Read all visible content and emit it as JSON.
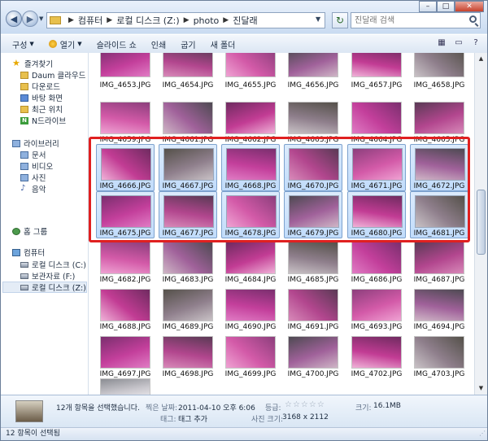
{
  "address": {
    "crumbs": [
      "컴퓨터",
      "로컬 디스크 (Z:)",
      "photo",
      "진달래"
    ]
  },
  "search": {
    "placeholder": "진달래 검색"
  },
  "toolbar": {
    "organize": "구성",
    "open": "열기",
    "slideshow": "슬라이드 쇼",
    "print": "인쇄",
    "burn": "굽기",
    "new_folder": "새 폴더"
  },
  "nav": {
    "favorites": "즐겨찾기",
    "daum_cloud": "Daum 클라우드",
    "downloads": "다운로드",
    "desktop": "바탕 화면",
    "recent": "최근 위치",
    "ndrive": "N드라이브",
    "libraries": "라이브러리",
    "documents": "문서",
    "videos": "비디오",
    "pictures": "사진",
    "music": "음악",
    "homegroup": "홈 그룹",
    "computer": "컴퓨터",
    "local_c": "로컬 디스크 (C:)",
    "backup_f": "보관자료 (F:)",
    "local_z": "로컬 디스크 (Z:)"
  },
  "files": {
    "row1": [
      "IMG_4653.JPG",
      "IMG_4654.JPG",
      "IMG_4655.JPG",
      "IMG_4656.JPG",
      "IMG_4657.JPG",
      "IMG_4658.JPG"
    ],
    "row2": [
      "IMG_4659.JPG",
      "IMG_4661.JPG",
      "IMG_4662.JPG",
      "IMG_4663.JPG",
      "IMG_4664.JPG",
      "IMG_4665.JPG"
    ],
    "row3": [
      "IMG_4666.JPG",
      "IMG_4667.JPG",
      "IMG_4668.JPG",
      "IMG_4670.JPG",
      "IMG_4671.JPG",
      "IMG_4672.JPG"
    ],
    "row4": [
      "IMG_4675.JPG",
      "IMG_4677.JPG",
      "IMG_4678.JPG",
      "IMG_4679.JPG",
      "IMG_4680.JPG",
      "IMG_4681.JPG"
    ],
    "row5": [
      "IMG_4682.JPG",
      "IMG_4683.JPG",
      "IMG_4684.JPG",
      "IMG_4685.JPG",
      "IMG_4686.JPG",
      "IMG_4687.JPG"
    ],
    "row6": [
      "IMG_4688.JPG",
      "IMG_4689.JPG",
      "IMG_4690.JPG",
      "IMG_4691.JPG",
      "IMG_4693.JPG",
      "IMG_4694.JPG"
    ],
    "row7": [
      "IMG_4697.JPG",
      "IMG_4698.JPG",
      "IMG_4699.JPG",
      "IMG_4700.JPG",
      "IMG_4702.JPG",
      "IMG_4703.JPG"
    ]
  },
  "details": {
    "summary": "12개 항목을 선택했습니다.",
    "date_label": "찍은 날짜:",
    "date_value": "2011-04-10 오후 6:06",
    "tags_label": "태그:",
    "tags_value": "태그 추가",
    "rating_label": "등급:",
    "rating_stars": "☆☆☆☆☆",
    "dims_label": "사진 크기:",
    "dims_value": "3168 x 2112",
    "size_label": "크기:",
    "size_value": "16.1MB"
  },
  "status": {
    "text": "12 항목이 선택됨"
  },
  "colors": {
    "selection_box": "#e02020",
    "azalea": "#c0328f",
    "selected_tile": "#c8dffb"
  }
}
